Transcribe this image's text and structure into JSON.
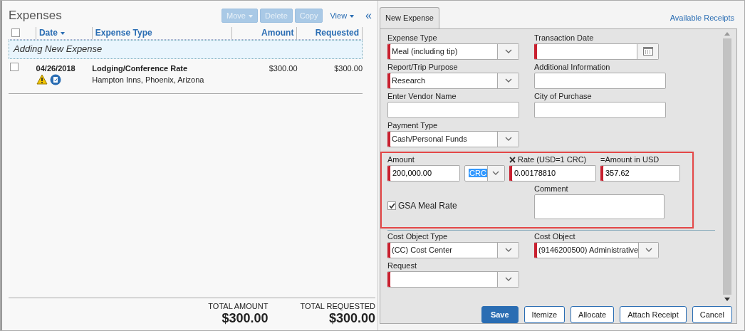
{
  "expenses": {
    "title": "Expenses",
    "toolbar": [
      {
        "label": "Move",
        "dropdown": true,
        "disabled": true
      },
      {
        "label": "Delete",
        "disabled": true
      },
      {
        "label": "Copy",
        "disabled": true
      },
      {
        "label": "View",
        "dropdown": true,
        "disabled": false
      }
    ],
    "collapse": "«",
    "columns": [
      {
        "label": "Date",
        "sorted": true
      },
      {
        "label": "Expense Type",
        "sorted": false
      },
      {
        "label": "Amount",
        "sorted": false
      },
      {
        "label": "Requested",
        "sorted": false
      }
    ],
    "select_all": {
      "checked": false
    },
    "adding_row": "Adding New Expense",
    "rows": [
      {
        "checked": false,
        "date": "04/26/2018",
        "expense_type": "Lodging/Conference Rate",
        "vendor": "Hampton Inns, Phoenix, Arizona",
        "amount": "$300.00",
        "requested": "$300.00"
      }
    ],
    "totals": [
      {
        "label": "TOTAL AMOUNT",
        "value": "$300.00"
      },
      {
        "label": "TOTAL REQUESTED",
        "value": "$300.00"
      }
    ]
  },
  "form": {
    "tabs": [
      {
        "label": "New Expense",
        "selected": true
      }
    ],
    "link": "Available Receipts",
    "sections": [
      {
        "rows": [
          [
            {
              "kind": "select",
              "label": "Expense Type",
              "value": "Meal (including tip)",
              "required": true
            },
            {
              "kind": "date",
              "label": "Transaction Date",
              "required": true
            }
          ],
          [
            {
              "kind": "select",
              "label": "Report/Trip Purpose",
              "value": "Research",
              "required": true
            },
            {
              "kind": "text",
              "label": "Additional Information",
              "required": false
            }
          ],
          [
            {
              "kind": "text",
              "label": "Enter Vendor Name",
              "required": false
            },
            {
              "kind": "text",
              "label": "City of Purchase",
              "required": false
            }
          ],
          [
            {
              "kind": "select",
              "label": "Payment Type",
              "value": "Cash/Personal Funds",
              "required": true
            }
          ]
        ]
      },
      {
        "highlighted": true,
        "rows": [
          [
            {
              "kind": "text",
              "label": "Amount",
              "value": "200,000.00",
              "required": true
            },
            {
              "kind": "select",
              "value": "CRC",
              "required": false,
              "text_selected": true
            },
            {
              "kind": "text",
              "label": "Rate (USD=1 CRC)",
              "value": "0.00178810",
              "required": true,
              "clearable": true
            },
            {
              "kind": "text",
              "label": "=Amount in USD",
              "value": "357.62",
              "required": true
            }
          ],
          [
            {
              "kind": "checkbox",
              "label": "GSA Meal Rate",
              "checked": true
            },
            "",
            {
              "kind": "textarea",
              "label": "Comment",
              "required": false
            }
          ]
        ]
      },
      {
        "divider": true,
        "rows": [
          [
            {
              "kind": "select",
              "label": "Cost Object Type",
              "value": "(CC) Cost Center",
              "required": true
            },
            {
              "kind": "select",
              "label": "Cost Object",
              "value": "(9146200500) Administrative",
              "required": true
            }
          ],
          [
            {
              "kind": "select",
              "label": "Request",
              "required": true
            }
          ]
        ]
      }
    ],
    "buttons": [
      {
        "label": "Save",
        "kind": "primary"
      },
      {
        "label": "Itemize",
        "kind": "secondary"
      },
      {
        "label": "Allocate",
        "kind": "secondary"
      },
      {
        "label": "Attach Receipt",
        "kind": "secondary"
      },
      {
        "label": "Cancel",
        "kind": "secondary"
      }
    ]
  }
}
